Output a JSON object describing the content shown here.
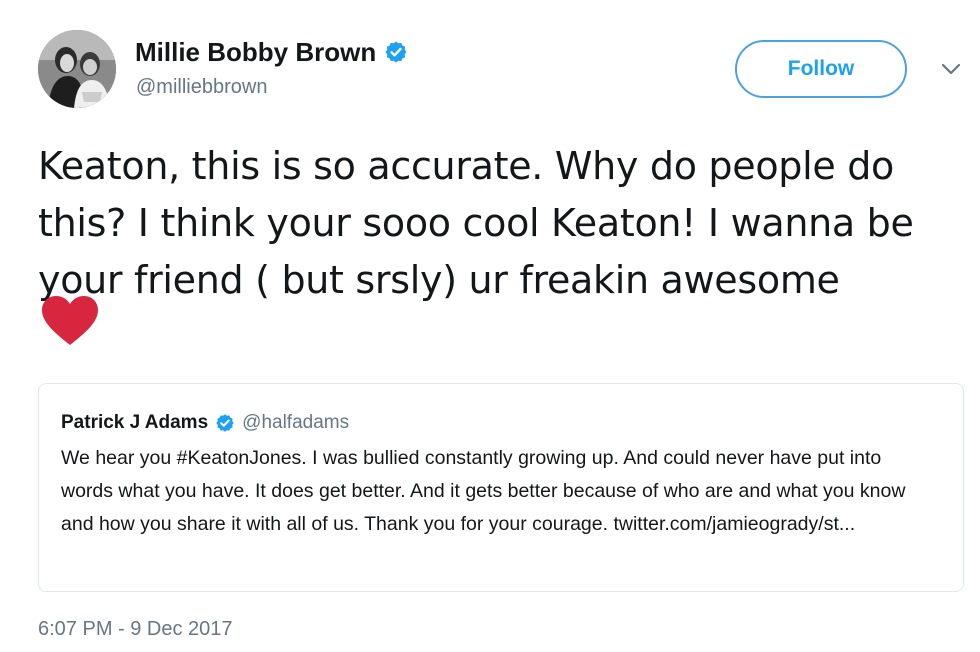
{
  "tweet": {
    "author": {
      "name": "Millie Bobby Brown",
      "handle": "@milliebbrown",
      "verified": true
    },
    "follow_label": "Follow",
    "text": "Keaton, this is so accurate. Why do people do this? I think your sooo cool Keaton! I wanna be your friend ( but srsly) ur freakin awesome",
    "emoji": "red-heart",
    "timestamp": "6:07 PM - 9 Dec 2017"
  },
  "quoted_tweet": {
    "author": {
      "name": "Patrick J Adams",
      "handle": "@halfadams",
      "verified": true
    },
    "text": "We hear you #KeatonJones. I was bullied constantly growing up. And could never have put into words what you have. It does get better. And it gets better because of who are and what you know and how you share it with all of us. Thank you for your courage. twitter.com/jamieogrady/st..."
  },
  "icons": {
    "verified": "verified-badge-icon",
    "caret": "chevron-down-icon",
    "heart": "heart-icon"
  },
  "colors": {
    "accent": "#1da1f2",
    "text": "#14171a",
    "secondary_text": "#657786",
    "heart": "#d7263d",
    "border": "#e1e8ed"
  }
}
